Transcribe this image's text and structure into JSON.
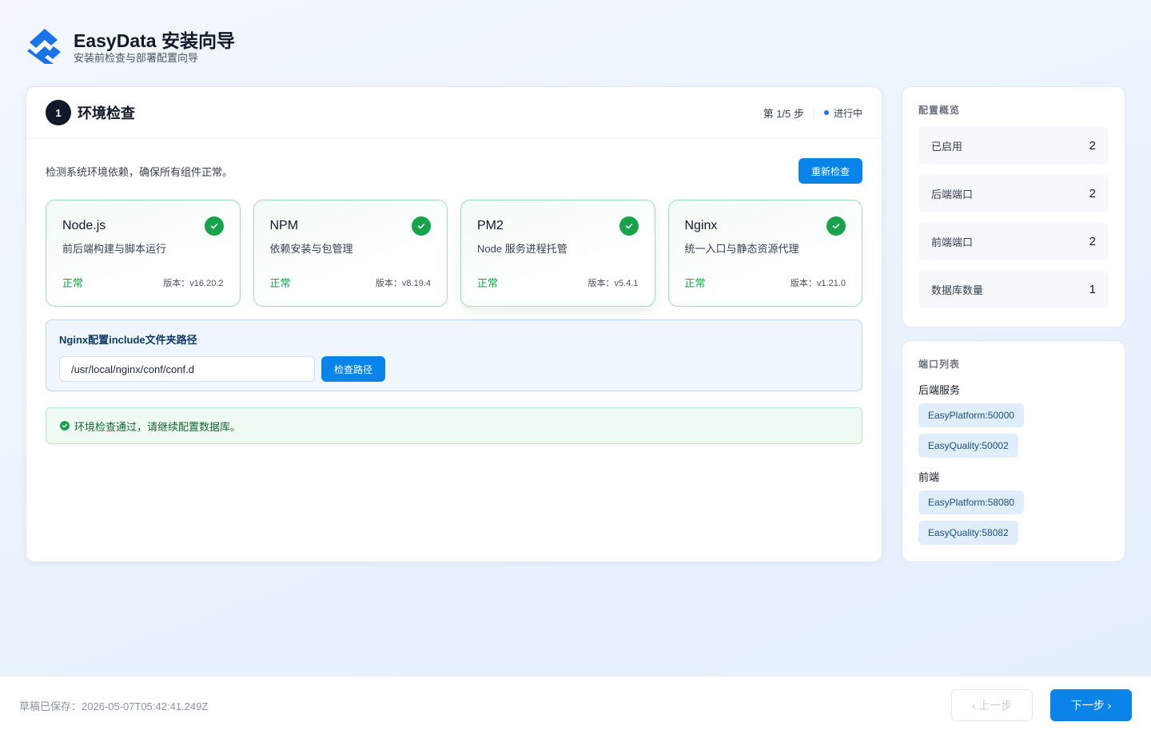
{
  "app": {
    "title": "EasyData 安装向导",
    "subtitle": "安装前检查与部署配置向导",
    "logo_icon": "stacked-diamond-logo"
  },
  "step": {
    "number": "1",
    "title": "环境检查",
    "progress": "第 1/5 步",
    "status": "进行中",
    "description": "检测系统环境依赖，确保所有组件正常。",
    "recheck_label": "重新检查"
  },
  "components": [
    {
      "name": "Node.js",
      "desc": "前后端构建与脚本运行",
      "status": "正常",
      "version": "版本：v16.20.2"
    },
    {
      "name": "NPM",
      "desc": "依赖安装与包管理",
      "status": "正常",
      "version": "版本：v8.19.4"
    },
    {
      "name": "PM2",
      "desc": "Node 服务进程托管",
      "status": "正常",
      "version": "版本：v5.4.1"
    },
    {
      "name": "Nginx",
      "desc": "统一入口与静态资源代理",
      "status": "正常",
      "version": "版本：v1.21.0"
    }
  ],
  "nginx": {
    "label": "Nginx配置include文件夹路径",
    "path_value": "/usr/local/nginx/conf/conf.d",
    "check_label": "检查路径"
  },
  "success_message": "环境检查通过，请继续配置数据库。",
  "summary": {
    "title": "配置概览",
    "items": [
      {
        "label": "已启用",
        "value": "2"
      },
      {
        "label": "后端端口",
        "value": "2"
      },
      {
        "label": "前端端口",
        "value": "2"
      },
      {
        "label": "数据库数量",
        "value": "1"
      }
    ]
  },
  "ports": {
    "title": "端口列表",
    "backend_label": "后端服务",
    "backend": [
      "EasyPlatform:50000",
      "EasyQuality:50002"
    ],
    "frontend_label": "前端",
    "frontend": [
      "EasyPlatform:58080",
      "EasyQuality:58082"
    ]
  },
  "footer": {
    "save_status": "草稿已保存：2026-05-07T05:42:41.249Z",
    "prev_label": "上一步",
    "next_label": "下一步"
  },
  "colors": {
    "accent": "#0b84ea",
    "success": "#16a34a",
    "dark": "#111827"
  }
}
